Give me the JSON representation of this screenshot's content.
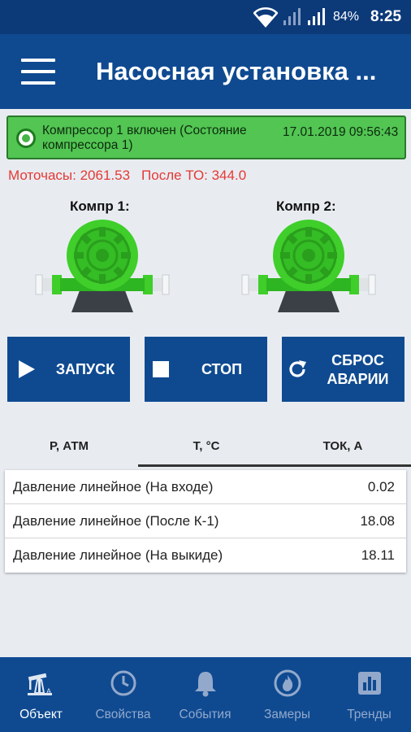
{
  "status_bar": {
    "battery": "84%",
    "time": "8:25"
  },
  "app_bar": {
    "title": "Насосная установка ..."
  },
  "alert": {
    "message": "Компрессор 1 включен (Состояние компрессора 1)",
    "timestamp": "17.01.2019 09:56:43"
  },
  "counters": {
    "motor_hours": "Моточасы: 2061.53",
    "after_service": "После ТО: 344.0"
  },
  "compressors": [
    {
      "label": "Компр 1:"
    },
    {
      "label": "Компр 2:"
    }
  ],
  "buttons": {
    "start": "ЗАПУСК",
    "stop": "СТОП",
    "reset_line1": "СБРОС",
    "reset_line2": "АВАРИИ"
  },
  "tabs": [
    {
      "label": "Р, АТМ"
    },
    {
      "label": "Т, °С"
    },
    {
      "label": "ТОК, А"
    }
  ],
  "table": {
    "rows": [
      {
        "label": "Давление линейное (На входе)",
        "value": "0.02"
      },
      {
        "label": "Давление линейное (После К-1)",
        "value": "18.08"
      },
      {
        "label": "Давление линейное (На выкиде)",
        "value": "18.11"
      }
    ]
  },
  "nav": [
    {
      "label": "Объект",
      "icon": "pump-jack-icon",
      "active": true
    },
    {
      "label": "Свойства",
      "icon": "clock-icon"
    },
    {
      "label": "События",
      "icon": "bell-icon"
    },
    {
      "label": "Замеры",
      "icon": "flame-icon"
    },
    {
      "label": "Тренды",
      "icon": "bar-chart-icon"
    }
  ]
}
